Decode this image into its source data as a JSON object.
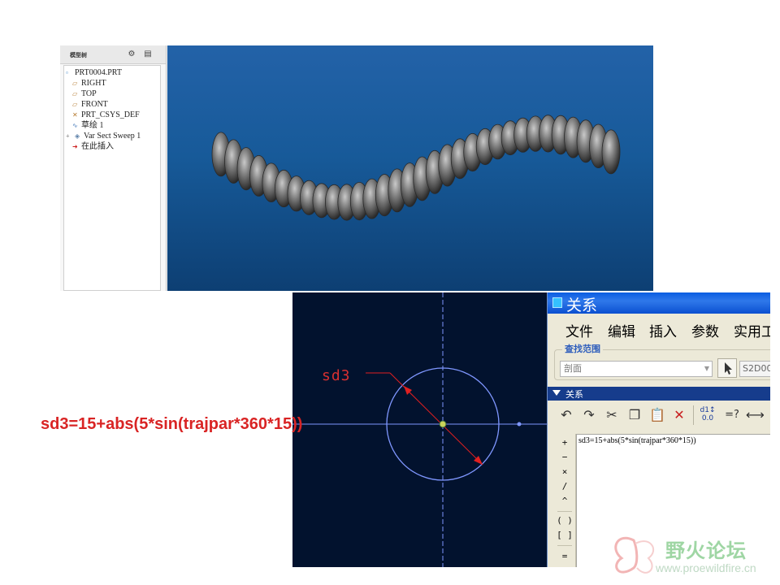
{
  "model_tree": {
    "title": "模型树",
    "items": [
      {
        "label": "PRT0004.PRT",
        "icon": "part-icon"
      },
      {
        "label": "RIGHT",
        "icon": "datum-plane-icon"
      },
      {
        "label": "TOP",
        "icon": "datum-plane-icon"
      },
      {
        "label": "FRONT",
        "icon": "datum-plane-icon"
      },
      {
        "label": "PRT_CSYS_DEF",
        "icon": "csys-icon"
      },
      {
        "label": "草绘 1",
        "icon": "sketch-icon"
      },
      {
        "label": "Var Sect Sweep 1",
        "icon": "sweep-feature-icon"
      },
      {
        "label": "在此插入",
        "icon": "insert-here-arrow-icon"
      }
    ]
  },
  "sketch": {
    "dimension_label": "sd3",
    "line_color": "#7f97ff",
    "dimension_color": "#e02020"
  },
  "formula_annotation": "sd3=15+abs(5*sin(trajpar*360*15))",
  "relations_dialog": {
    "title": "关系",
    "menu": [
      "文件",
      "编辑",
      "插入",
      "参数",
      "实用工"
    ],
    "find_scope_legend": "查找范围",
    "scope_selected": "剖面",
    "scope_field": "S2D00",
    "relations_section_label": "关系",
    "operators": [
      "+",
      "−",
      "×",
      "/",
      "^",
      "( )",
      "[ ]",
      "="
    ],
    "relation_text": "sd3=15+abs(5*sin(trajpar*360*15))"
  },
  "watermark": {
    "name": "野火论坛",
    "url": "www.proewildfire.cn"
  }
}
